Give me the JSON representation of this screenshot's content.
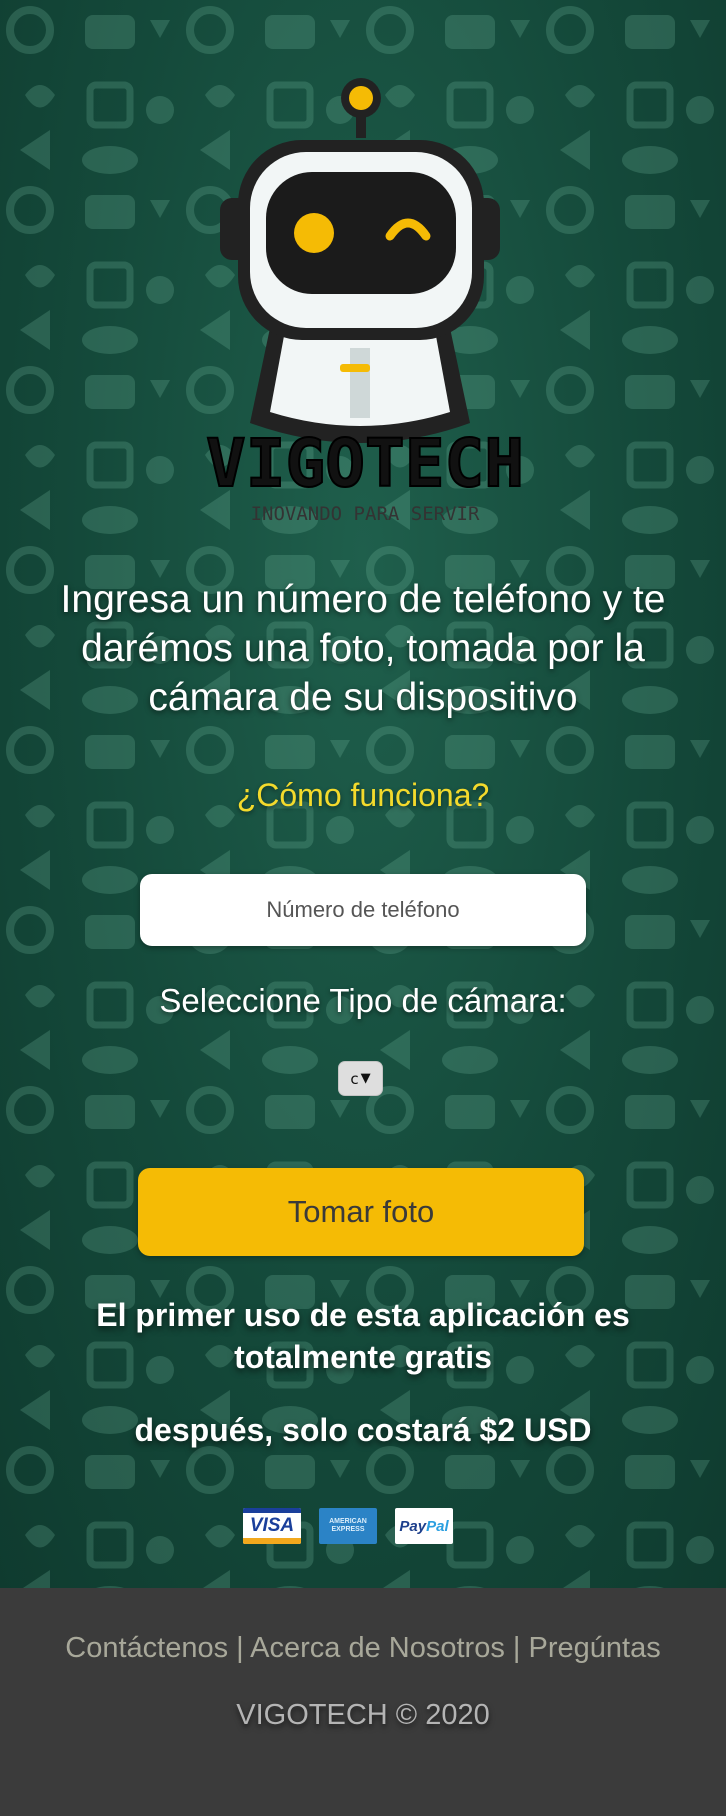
{
  "brand": {
    "name": "VIGOTECH",
    "tagline": "INOVANDO PARA SERVIR"
  },
  "main": {
    "headline": "Ingresa un número de teléfono y te darémos una foto, tomada por la cámara de su dispositivo",
    "how_link": "¿Cómo funciona?",
    "phone_placeholder": "Número de teléfono",
    "phone_value": "",
    "camera_label": "Seleccione Tipo de cámara:",
    "camera_selected": "c",
    "submit_label": "Tomar foto",
    "free_notice": "El primer uso de esta aplicación es totalmente gratis",
    "price_notice": "después, solo costará $2 USD"
  },
  "payments": {
    "visa": "VISA",
    "amex_line1": "AMERICAN",
    "amex_line2": "EXPRESS",
    "paypal_pay": "Pay",
    "paypal_pal": "Pal"
  },
  "footer": {
    "contact": "Contáctenos",
    "about": "Acerca de Nosotros",
    "faq": "Pregúntas",
    "separator": "|",
    "copyright": "VIGOTECH © 2020"
  },
  "colors": {
    "background": "#14493a",
    "accent_yellow": "#f5bb05",
    "link_yellow": "#f3da2c",
    "footer_bg": "#3b3b3b"
  },
  "icons": {
    "logo": "robot-mascot-icon",
    "dropdown": "triangle-down-icon"
  }
}
